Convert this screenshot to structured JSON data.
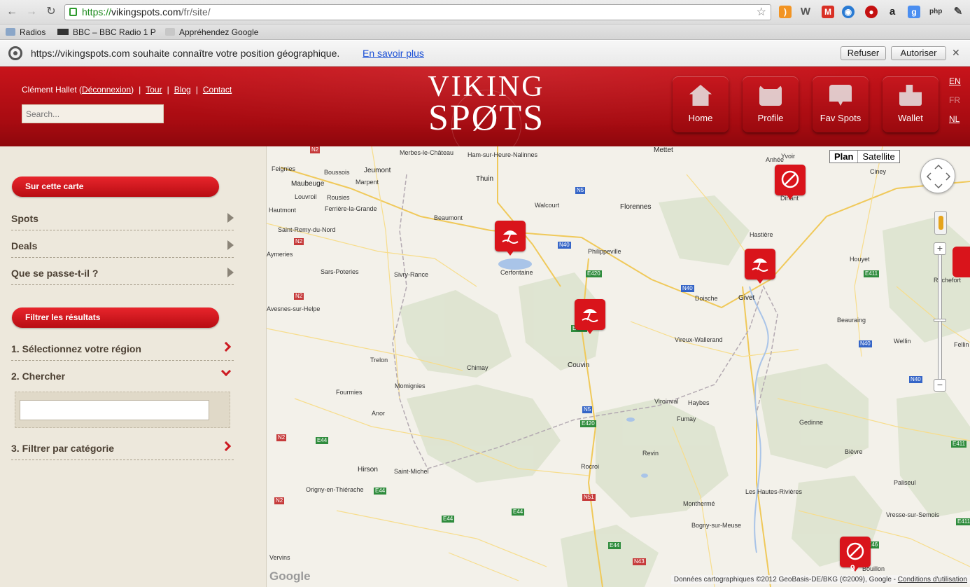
{
  "browser": {
    "url_scheme": "https://",
    "url_host": "vikingspots.com",
    "url_path": "/fr/site/",
    "bookmarks": [
      "Radios",
      "BBC – BBC Radio 1 P",
      "Appréhendez Google"
    ],
    "extensions": [
      "rss-icon",
      "w-icon",
      "gmail-icon",
      "globe-icon",
      "adblock-icon",
      "amazon-icon",
      "google-icon",
      "php-icon",
      "wrench-icon"
    ]
  },
  "infobar": {
    "message": "https://vikingspots.com souhaite connaître votre position géographique.",
    "learn_more": "En savoir plus",
    "deny": "Refuser",
    "allow": "Autoriser",
    "close": "✕"
  },
  "header": {
    "user": "Clément Hallet",
    "logout": "Déconnexion",
    "links": [
      "Tour",
      "Blog",
      "Contact"
    ],
    "search_placeholder": "Search...",
    "logo_line1": "VIKING",
    "logo_line2": "SPØTS",
    "nav": [
      "Home",
      "Profile",
      "Fav Spots",
      "Wallet"
    ],
    "languages": [
      "EN",
      "FR",
      "NL"
    ]
  },
  "sidebar": {
    "section1": "Sur cette carte",
    "section1_items": [
      "Spots",
      "Deals",
      "Que se passe-t-il ?"
    ],
    "section2": "Filtrer les résultats",
    "filters": [
      "1. Sélectionnez votre région",
      "2. Chercher",
      "3. Filtrer par catégorie"
    ]
  },
  "map": {
    "type_plan": "Plan",
    "type_satellite": "Satellite",
    "zoom_in": "+",
    "zoom_out": "−",
    "cluster_count": "9",
    "google": "Google",
    "copyright": "Données cartographiques ©2012 GeoBasis-DE/BKG (©2009), Google -",
    "terms": "Conditions d'utilisation",
    "places": [
      "Merbes-le-Château",
      "Ham-sur-Heure-Nalinnes",
      "Mettet",
      "Yvoir",
      "Anhée",
      "Ciney",
      "Feignies",
      "Boussois",
      "Jeumont",
      "Maubeuge",
      "Marpent",
      "Louvroil",
      "Rousies",
      "Thuin",
      "Hautmont",
      "Ferrière-la-Grande",
      "Walcourt",
      "Florennes",
      "Dinant",
      "Beaumont",
      "Saint-Remy-du-Nord",
      "Aymeries",
      "Philippeville",
      "Hastière",
      "Sars-Poteries",
      "Cerfontaine",
      "Sivry-Rance",
      "Houyet",
      "Rochefort",
      "Avesnes-sur-Helpe",
      "Doische",
      "Givet",
      "Beauraing",
      "Vireux-Wallerand",
      "Wellin",
      "Trelon",
      "Chimay",
      "Couvin",
      "Momignies",
      "Fellin",
      "Fourmies",
      "Viroinval",
      "Haybes",
      "Anor",
      "Fumay",
      "Gedinne",
      "Revin",
      "Bièvre",
      "Hirson",
      "Saint-Michel",
      "Rocroi",
      "Paliseul",
      "Origny-en-Thiérache",
      "Les Hautes-Rivières",
      "Monthermé",
      "Vresse-sur-Semois",
      "Bogny-sur-Meuse",
      "Vervins",
      "Bouillon"
    ],
    "roads": [
      "N2",
      "N5",
      "N40",
      "E420",
      "N2",
      "N2",
      "E420",
      "N40",
      "N40",
      "E411",
      "N40",
      "N5",
      "E420",
      "N2",
      "E44",
      "E44",
      "N2",
      "E44",
      "E44",
      "N51",
      "E44",
      "N43",
      "E46",
      "E411",
      "E411"
    ]
  },
  "colors": {
    "brand_red": "#c8141b",
    "sidebar_bg": "#ede8dc",
    "map_bg": "#f3f1ea",
    "marker_red": "#d9141b"
  }
}
